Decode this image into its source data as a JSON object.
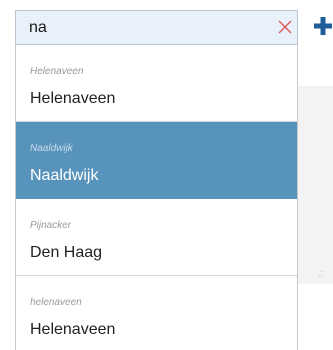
{
  "search": {
    "value": "na",
    "clear_icon": "close-icon",
    "clear_color": "#e05a5a",
    "add_icon": "plus-icon",
    "add_color": "#1f5d99"
  },
  "dropdown": {
    "selected_color": "#5893bc",
    "options": [
      {
        "sub": "Helenaveen",
        "label": "Helenaveen",
        "selected": false
      },
      {
        "sub": "Naaldwijk",
        "label": "Naaldwijk",
        "selected": true
      },
      {
        "sub": "Pijnacker",
        "label": "Den Haag",
        "selected": false
      },
      {
        "sub": "helenaveen",
        "label": "Helenaveen",
        "selected": false
      }
    ]
  }
}
